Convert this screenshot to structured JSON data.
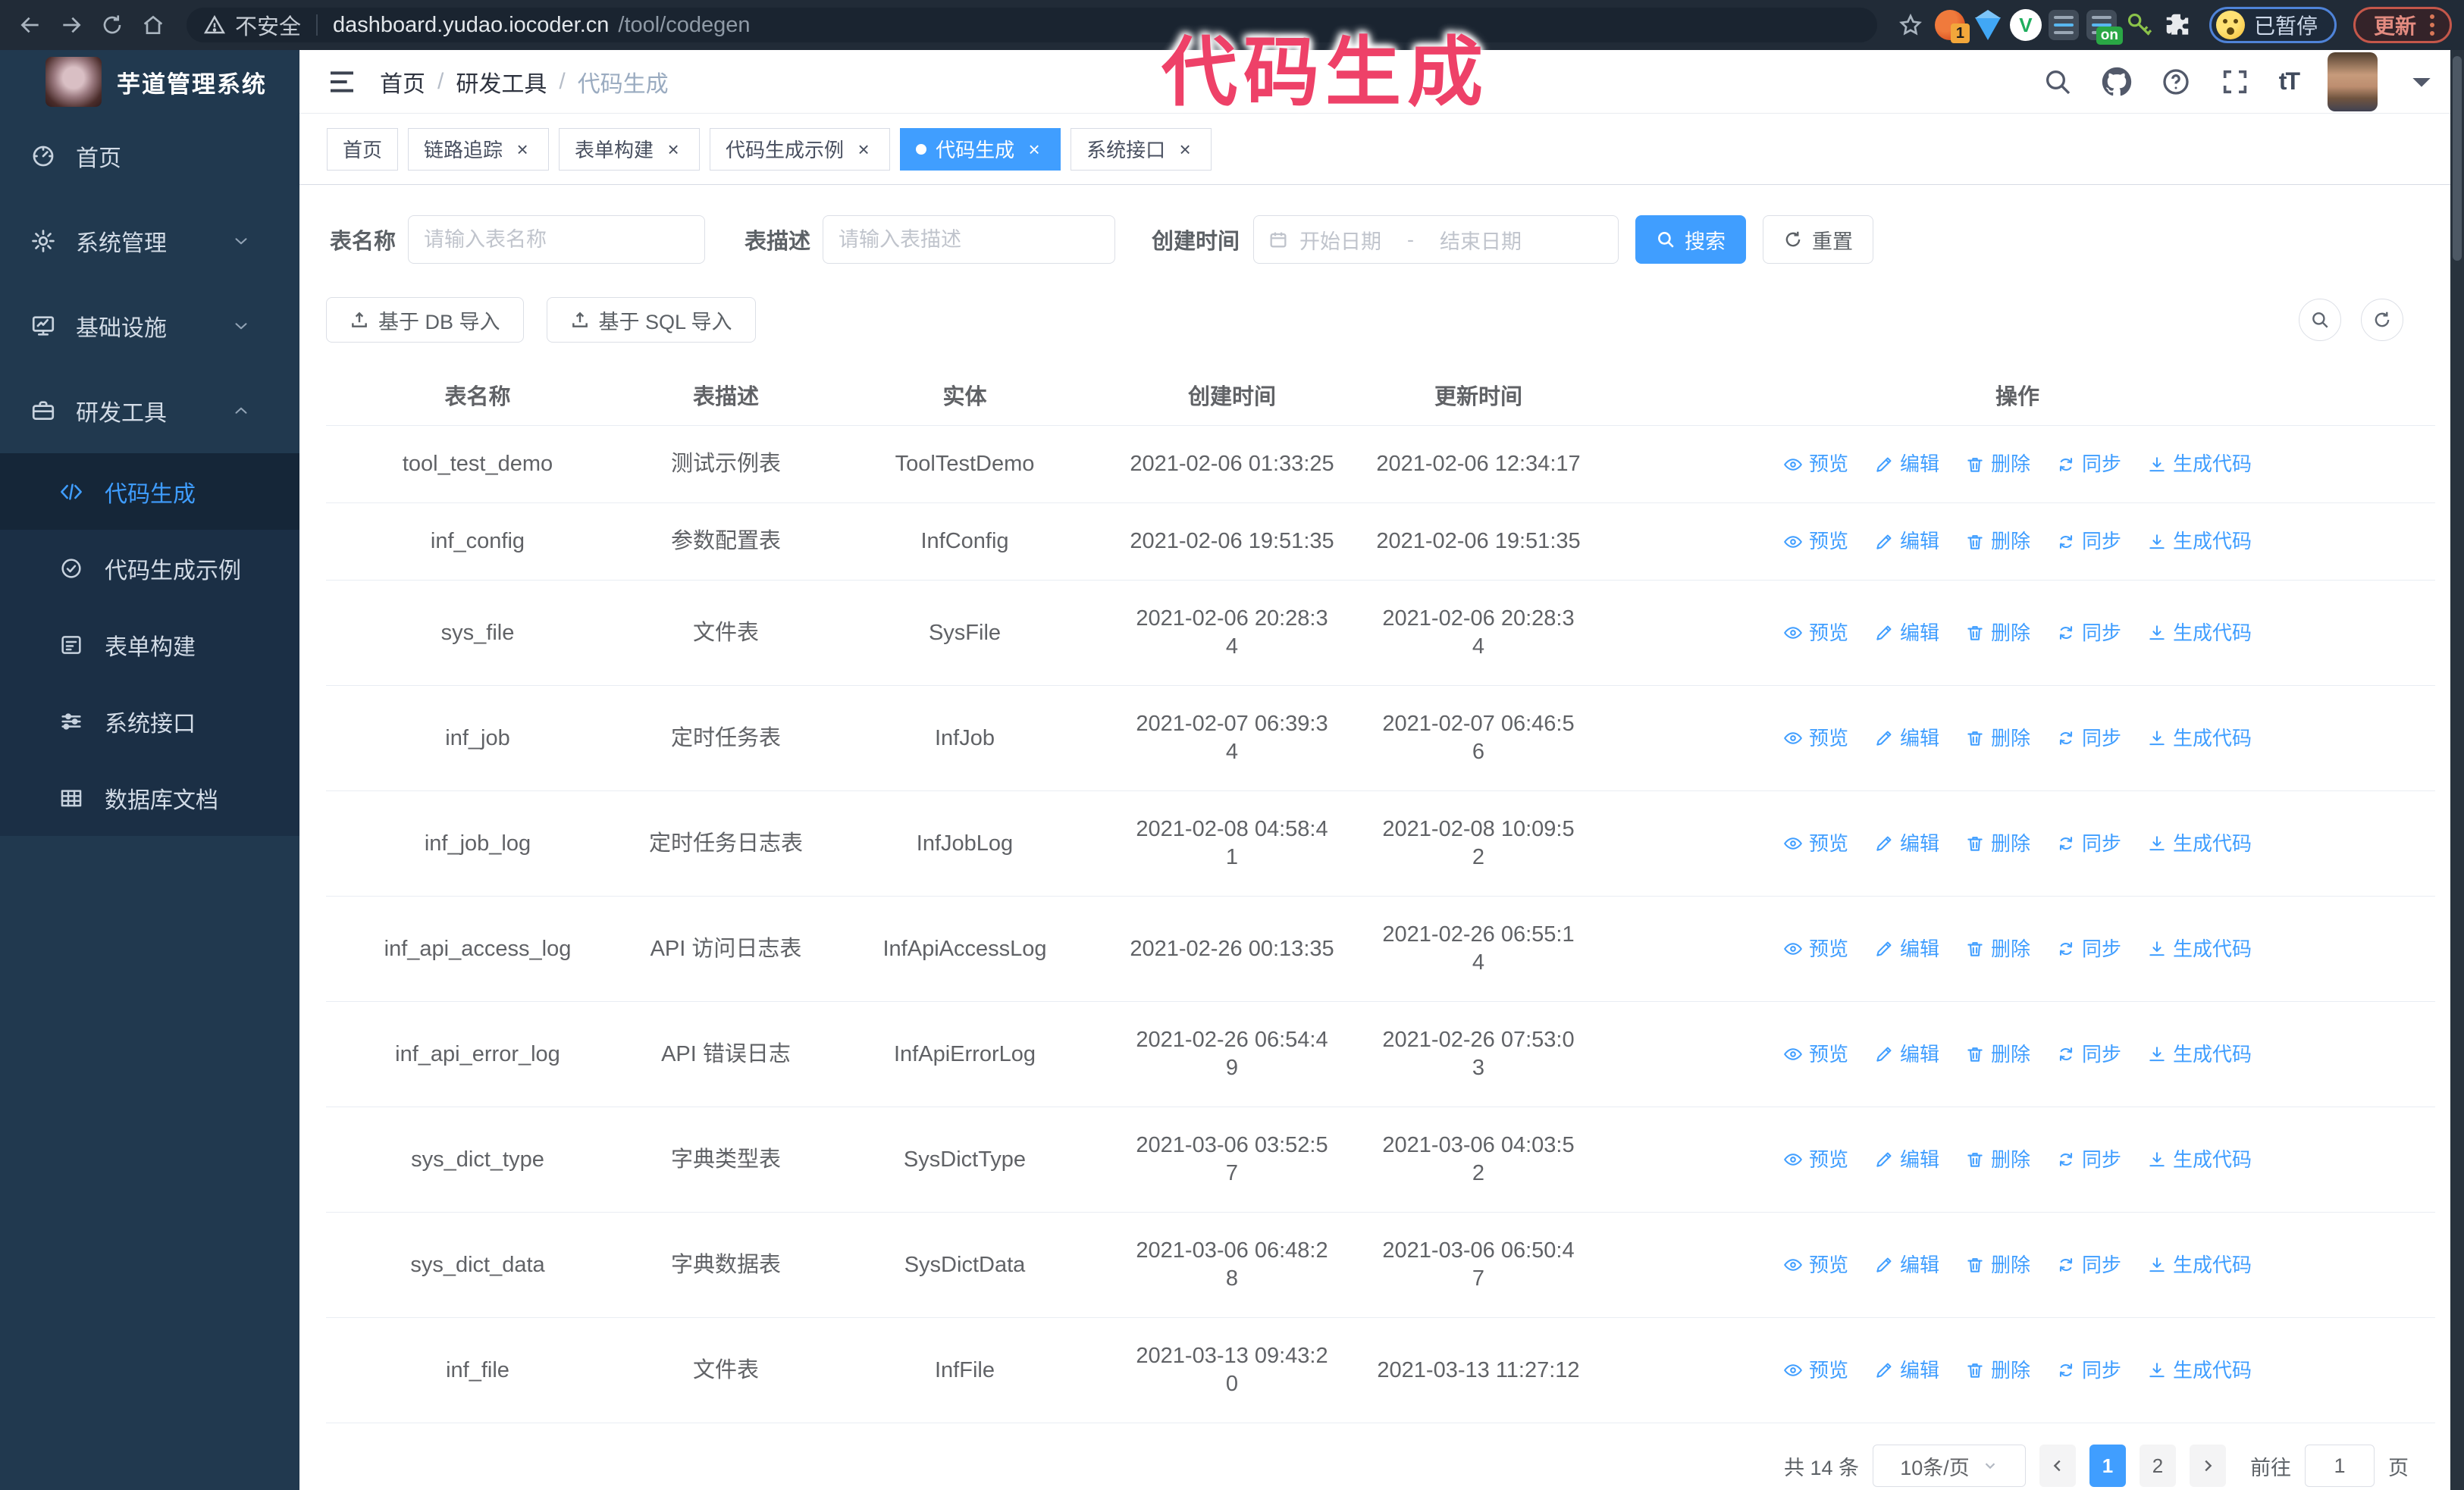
{
  "colors": {
    "accent": "#409eff",
    "sidebar_bg": "#21394f",
    "submenu_bg": "#1b2f45",
    "annotation": "#ee4168",
    "chrome_bg": "#212b37"
  },
  "browser": {
    "security_label": "不安全",
    "url_host": "dashboard.yudao.iocoder.cn",
    "url_path": "/tool/codegen",
    "extension_badge": "1",
    "extension_on_badge": "on",
    "paused_badge": "已暂停",
    "update_button": "更新"
  },
  "annotation": {
    "text": "代码生成"
  },
  "sidebar": {
    "logo_title": "芋道管理系统",
    "items": [
      {
        "label": "首页",
        "icon": "dashboard-icon",
        "chevron": ""
      },
      {
        "label": "系统管理",
        "icon": "gear-icon",
        "chevron": "down"
      },
      {
        "label": "基础设施",
        "icon": "monitor-icon",
        "chevron": "down"
      },
      {
        "label": "研发工具",
        "icon": "toolbox-icon",
        "chevron": "up"
      }
    ],
    "submenu": [
      {
        "label": "代码生成",
        "icon": "code-icon",
        "active": true
      },
      {
        "label": "代码生成示例",
        "icon": "badge-check-icon",
        "active": false
      },
      {
        "label": "表单构建",
        "icon": "form-icon",
        "active": false
      },
      {
        "label": "系统接口",
        "icon": "sliders-icon",
        "active": false
      },
      {
        "label": "数据库文档",
        "icon": "database-doc-icon",
        "active": false
      }
    ]
  },
  "header": {
    "breadcrumb": [
      "首页",
      "研发工具",
      "代码生成"
    ]
  },
  "tabs": [
    {
      "label": "首页",
      "closable": false,
      "active": false
    },
    {
      "label": "链路追踪",
      "closable": true,
      "active": false
    },
    {
      "label": "表单构建",
      "closable": true,
      "active": false
    },
    {
      "label": "代码生成示例",
      "closable": true,
      "active": false
    },
    {
      "label": "代码生成",
      "closable": true,
      "active": true
    },
    {
      "label": "系统接口",
      "closable": true,
      "active": false
    }
  ],
  "filters": {
    "table_name_label": "表名称",
    "table_name_placeholder": "请输入表名称",
    "table_desc_label": "表描述",
    "table_desc_placeholder": "请输入表描述",
    "create_time_label": "创建时间",
    "date_start_placeholder": "开始日期",
    "date_separator": "-",
    "date_end_placeholder": "结束日期",
    "search_label": "搜索",
    "reset_label": "重置"
  },
  "toolbar": {
    "import_db_label": "基于 DB 导入",
    "import_sql_label": "基于 SQL 导入"
  },
  "table": {
    "columns": [
      "表名称",
      "表描述",
      "实体",
      "创建时间",
      "更新时间",
      "操作"
    ],
    "actions": [
      {
        "label": "预览",
        "icon": "eye-icon"
      },
      {
        "label": "编辑",
        "icon": "edit-icon"
      },
      {
        "label": "删除",
        "icon": "delete-icon"
      },
      {
        "label": "同步",
        "icon": "sync-icon"
      },
      {
        "label": "生成代码",
        "icon": "download-icon"
      }
    ],
    "rows": [
      {
        "name": "tool_test_demo",
        "desc": "测试示例表",
        "entity": "ToolTestDemo",
        "created": "2021-02-06 01:33:25",
        "updated": "2021-02-06 12:34:17"
      },
      {
        "name": "inf_config",
        "desc": "参数配置表",
        "entity": "InfConfig",
        "created": "2021-02-06 19:51:35",
        "updated": "2021-02-06 19:51:35"
      },
      {
        "name": "sys_file",
        "desc": "文件表",
        "entity": "SysFile",
        "created": "2021-02-06 20:28:3\n4",
        "updated": "2021-02-06 20:28:3\n4"
      },
      {
        "name": "inf_job",
        "desc": "定时任务表",
        "entity": "InfJob",
        "created": "2021-02-07 06:39:3\n4",
        "updated": "2021-02-07 06:46:5\n6"
      },
      {
        "name": "inf_job_log",
        "desc": "定时任务日志表",
        "entity": "InfJobLog",
        "created": "2021-02-08 04:58:4\n1",
        "updated": "2021-02-08 10:09:5\n2"
      },
      {
        "name": "inf_api_access_log",
        "desc": "API 访问日志表",
        "entity": "InfApiAccessLog",
        "created": "2021-02-26 00:13:35",
        "updated": "2021-02-26 06:55:1\n4"
      },
      {
        "name": "inf_api_error_log",
        "desc": "API 错误日志",
        "entity": "InfApiErrorLog",
        "created": "2021-02-26 06:54:4\n9",
        "updated": "2021-02-26 07:53:0\n3"
      },
      {
        "name": "sys_dict_type",
        "desc": "字典类型表",
        "entity": "SysDictType",
        "created": "2021-03-06 03:52:5\n7",
        "updated": "2021-03-06 04:03:5\n2"
      },
      {
        "name": "sys_dict_data",
        "desc": "字典数据表",
        "entity": "SysDictData",
        "created": "2021-03-06 06:48:2\n8",
        "updated": "2021-03-06 06:50:4\n7"
      },
      {
        "name": "inf_file",
        "desc": "文件表",
        "entity": "InfFile",
        "created": "2021-03-13 09:43:2\n0",
        "updated": "2021-03-13 11:27:12"
      }
    ]
  },
  "pagination": {
    "total_label": "共 14 条",
    "page_size": "10条/页",
    "pages": [
      "1",
      "2"
    ],
    "active_page": "1",
    "goto_label": "前往",
    "goto_value": "1",
    "goto_suffix": "页"
  }
}
